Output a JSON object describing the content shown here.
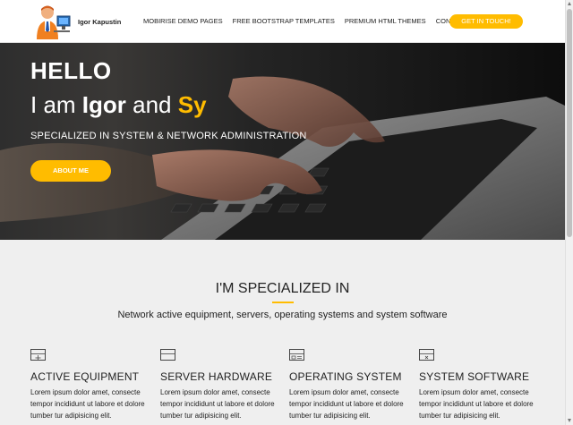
{
  "brand": {
    "name": "Igor Kapustin"
  },
  "nav": {
    "links": [
      "MOBIRISE DEMO PAGES",
      "FREE BOOTSTRAP TEMPLATES",
      "PREMIUM HTML THEMES",
      "CONTACTS"
    ],
    "cta_label": "GET IN TOUCH!"
  },
  "hero": {
    "title": "HELLO",
    "sub_prefix": "I am ",
    "sub_name": "Igor",
    "sub_mid": " and ",
    "sub_accent": "Sy",
    "specialized": "SPECIALIZED IN SYSTEM & NETWORK ADMINISTRATION",
    "button_label": "ABOUT ME"
  },
  "section": {
    "title": "I'M SPECIALIZED IN",
    "subtitle": "Network active equipment, servers, operating systems and system software"
  },
  "features": [
    {
      "icon": "network-device-icon",
      "title": "ACTIVE EQUIPMENT",
      "text": "Lorem ipsum dolor amet, consecte tempor incididunt ut labore et dolore tumber tur adipisicing elit."
    },
    {
      "icon": "server-icon",
      "title": "SERVER HARDWARE",
      "text": "Lorem ipsum dolor amet, consecte tempor incididunt ut labore et dolore tumber tur adipisicing elit."
    },
    {
      "icon": "window-icon",
      "title": "OPERATING SYSTEM",
      "text": "Lorem ipsum dolor amet, consecte tempor incididunt ut labore et dolore tumber tur adipisicing elit."
    },
    {
      "icon": "app-window-icon",
      "title": "SYSTEM SOFTWARE",
      "text": "Lorem ipsum dolor amet, consecte tempor incididunt ut labore et dolore tumber tur adipisicing elit."
    }
  ],
  "colors": {
    "accent": "#ffbc00",
    "hero_bg": "#1a1a1a",
    "page_bg": "#efefef"
  }
}
